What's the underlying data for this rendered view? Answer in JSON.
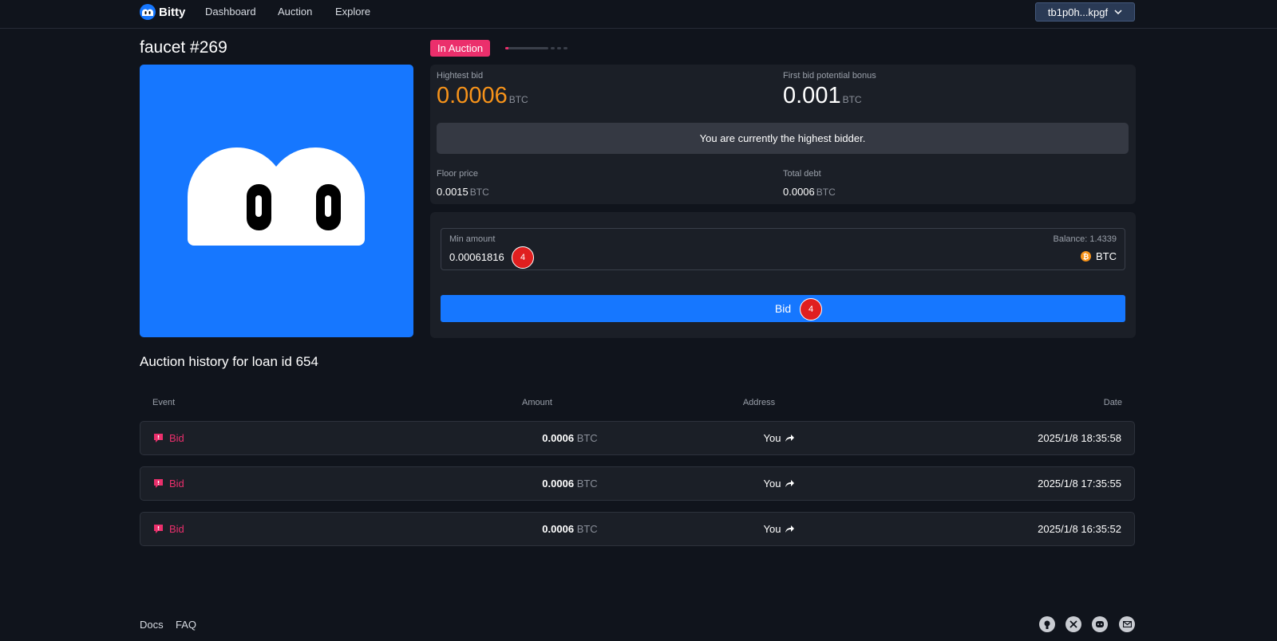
{
  "nav": {
    "brand": "Bitty",
    "links": [
      "Dashboard",
      "Auction",
      "Explore"
    ],
    "wallet": "tb1p0h...kpgf"
  },
  "nft": {
    "title": "faucet #269"
  },
  "status": {
    "badge": "In Auction"
  },
  "stats": {
    "highest_bid_label": "Hightest bid",
    "highest_bid": "0.0006",
    "first_bid_bonus_label": "First bid potential bonus",
    "first_bid_bonus": "0.001",
    "unit": "BTC",
    "notice": "You are currently the highest bidder.",
    "floor_label": "Floor price",
    "floor": "0.0015",
    "debt_label": "Total debt",
    "debt": "0.0006"
  },
  "bid_form": {
    "min_label": "Min amount",
    "balance": "Balance: 1.4339",
    "amount": "0.00061816",
    "currency": "BTC",
    "button": "Bid",
    "badge_count": "4"
  },
  "history": {
    "title": "Auction history for loan id 654",
    "headers": [
      "Event",
      "Amount",
      "Address",
      "Date"
    ],
    "rows": [
      {
        "event": "Bid",
        "amount": "0.0006",
        "unit": "BTC",
        "address": "You",
        "date": "2025/1/8 18:35:58"
      },
      {
        "event": "Bid",
        "amount": "0.0006",
        "unit": "BTC",
        "address": "You",
        "date": "2025/1/8 17:35:55"
      },
      {
        "event": "Bid",
        "amount": "0.0006",
        "unit": "BTC",
        "address": "You",
        "date": "2025/1/8 16:35:52"
      }
    ]
  },
  "footer": {
    "links": [
      "Docs",
      "FAQ"
    ],
    "icons": [
      "github-icon",
      "x-icon",
      "discord-icon",
      "mail-icon"
    ]
  },
  "colors": {
    "accent": "#1677ff",
    "pink": "#eb2f6c",
    "orange": "#f7931a",
    "bg": "#10141c",
    "panel": "#1b1f27"
  }
}
